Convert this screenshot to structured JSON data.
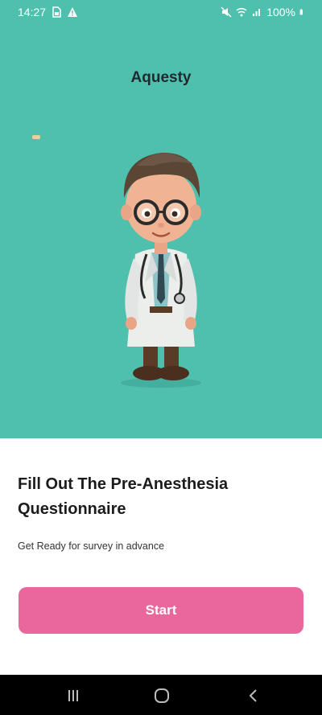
{
  "status_bar": {
    "time": "14:27",
    "battery": "100%",
    "left_icons": [
      "sim-card-icon",
      "warning-icon"
    ],
    "right_icons": [
      "mute-icon",
      "wifi-icon",
      "signal-icon",
      "battery-icon"
    ]
  },
  "header": {
    "app_title": "Aquesty"
  },
  "hero": {
    "illustration": "doctor-character"
  },
  "content": {
    "headline": "Fill Out The Pre-Anesthesia Questionnaire",
    "subtitle": "Get Ready for survey in advance",
    "start_label": "Start"
  },
  "nav_bar": {
    "buttons": [
      "recent-apps-icon",
      "home-icon",
      "back-icon"
    ]
  },
  "colors": {
    "hero_background": "#4fbfae",
    "accent_button": "#e9679c",
    "text_dark": "#1c1c1c"
  }
}
